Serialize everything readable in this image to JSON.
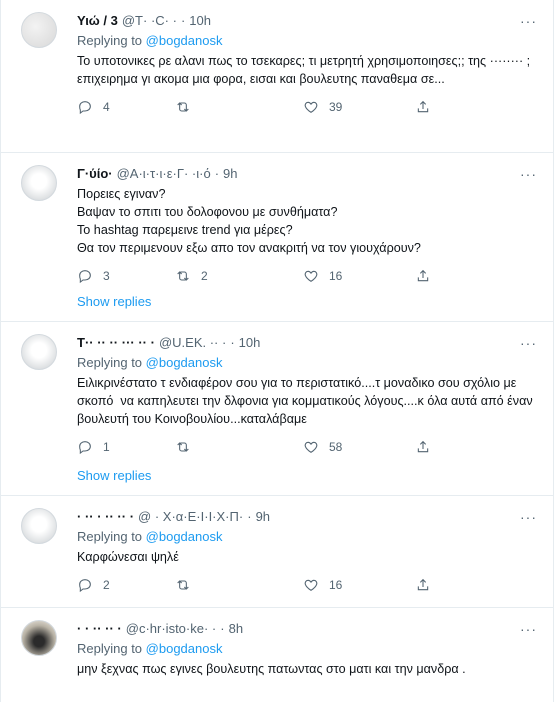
{
  "tweets": [
    {
      "name": "Υιώ / 3",
      "handle": "@T· ·C· ·",
      "time": "10h",
      "replying_prefix": "Replying to",
      "replying_to": "@bogdanosk",
      "text": "Το υποτονικες ρε αλανι πως το τσεκαρες; τι μετρητή χρησιμοποιησες;; της ········ ; επιχειρημα γι ακομα μια φορα, εισαι και βουλευτης παναθεμα σε...",
      "replies": "4",
      "retweets": "",
      "likes": "39"
    },
    {
      "name": "Γ·ύίο·",
      "handle": "@Α·ι·τ·ι·ε·Γ· ·ι·ό",
      "time": "9h",
      "replying_prefix": "",
      "replying_to": "",
      "text": "Πορειες εγιναν?\nΒαψαν το σπιτι του δολοφονου με συνθήματα?\nΤο hashtag παρεμεινε trend για μέρες?\nΘα τον περιμενουν εξω απο τον ανακριτή να τον γιουχάρουν?",
      "replies": "3",
      "retweets": "2",
      "likes": "16",
      "show_replies": "Show replies"
    },
    {
      "name": "Τ·· ·· ·· ··· ·· ·",
      "handle": "@U.ΕΚ. ·· ·",
      "time": "10h",
      "replying_prefix": "Replying to",
      "replying_to": "@bogdanosk",
      "text": "Ειλικρινέστατο τ ενδιαφέρον σου για το περιστατικό....τ μοναδικο σου σχόλιο με σκοπό  να καπηλευτει την δλφονια για κομματικούς λόγους....κ όλα αυτά από έναν βουλευτή του Κοινοβουλίου...καταλάβαμε",
      "replies": "1",
      "retweets": "",
      "likes": "58",
      "show_replies": "Show replies"
    },
    {
      "name": "· ·· · ·· ·· ·",
      "handle": "@ · Χ·α·Ε·Ι·Ι·Χ·Π·",
      "time": "9h",
      "replying_prefix": "Replying to",
      "replying_to": "@bogdanosk",
      "text": "Καρφώνεσαι ψηλέ",
      "replies": "2",
      "retweets": "",
      "likes": "16"
    },
    {
      "name": "· · ·· ·· ·",
      "handle": "@c·hr·isto·ke· ·",
      "time": "8h",
      "replying_prefix": "Replying to",
      "replying_to": "@bogdanosk",
      "text": "μην ξεχνας πως εγινες βουλευτης πατωντας στο ματι και την μανδρα .",
      "replies": "",
      "retweets": "",
      "likes": ""
    }
  ],
  "icons": {
    "reply": "reply-icon",
    "retweet": "retweet-icon",
    "like": "heart-icon",
    "share": "share-icon",
    "more": "more-icon"
  },
  "colors": {
    "link": "#1d9bf0",
    "muted": "#536471",
    "divider": "#e6ecf0"
  }
}
